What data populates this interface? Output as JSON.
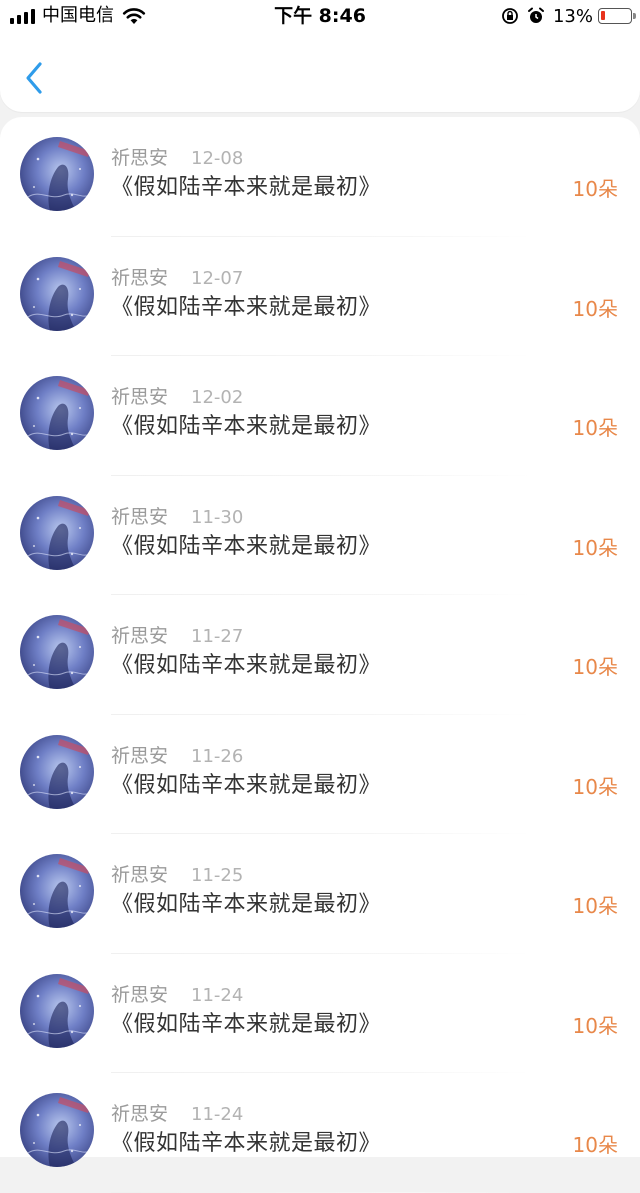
{
  "status_bar": {
    "carrier": "中国电信",
    "time": "下午 8:46",
    "battery_percent": "13%",
    "icons": [
      "signal-icon",
      "wifi-icon",
      "orientation-lock-icon",
      "alarm-icon",
      "battery-icon"
    ]
  },
  "nav": {
    "back_icon": "chevron-left-icon",
    "accent_color": "#2f9cea"
  },
  "colors": {
    "amount": "#e8884a",
    "name": "#9b9b9b",
    "date": "#b3b3b3",
    "title": "#333333"
  },
  "records": [
    {
      "name": "祈思安",
      "date": "12-08",
      "title": "《假如陆辛本来就是最初》",
      "amount": "10朵"
    },
    {
      "name": "祈思安",
      "date": "12-07",
      "title": "《假如陆辛本来就是最初》",
      "amount": "10朵"
    },
    {
      "name": "祈思安",
      "date": "12-02",
      "title": "《假如陆辛本来就是最初》",
      "amount": "10朵"
    },
    {
      "name": "祈思安",
      "date": "11-30",
      "title": "《假如陆辛本来就是最初》",
      "amount": "10朵"
    },
    {
      "name": "祈思安",
      "date": "11-27",
      "title": "《假如陆辛本来就是最初》",
      "amount": "10朵"
    },
    {
      "name": "祈思安",
      "date": "11-26",
      "title": "《假如陆辛本来就是最初》",
      "amount": "10朵"
    },
    {
      "name": "祈思安",
      "date": "11-25",
      "title": "《假如陆辛本来就是最初》",
      "amount": "10朵"
    },
    {
      "name": "祈思安",
      "date": "11-24",
      "title": "《假如陆辛本来就是最初》",
      "amount": "10朵"
    },
    {
      "name": "祈思安",
      "date": "11-24",
      "title": "《假如陆辛本来就是最初》",
      "amount": "10朵"
    }
  ]
}
